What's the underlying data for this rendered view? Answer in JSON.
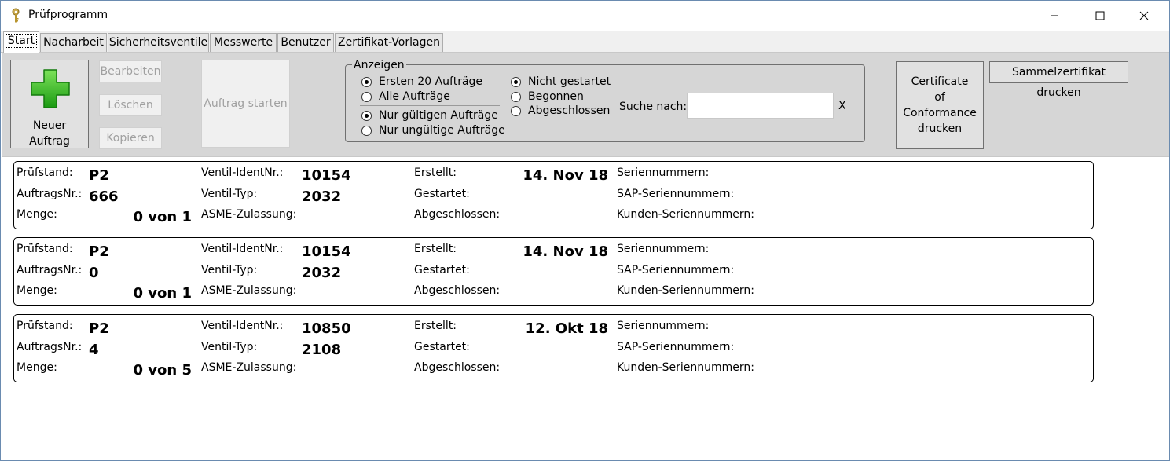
{
  "window": {
    "title": "Prüfprogramm",
    "minimize_glyph": "—",
    "maximize_glyph": "☐",
    "close_glyph": "✕"
  },
  "tabs": [
    "Start",
    "Nacharbeit",
    "Sicherheitsventile",
    "Messwerte",
    "Benutzer",
    "Zertifikat-Vorlagen"
  ],
  "toolbar": {
    "new_order_label_line1": "Neuer",
    "new_order_label_line2": "Auftrag",
    "edit_label": "Bearbeiten",
    "delete_label": "Löschen",
    "copy_label": "Kopieren",
    "start_order_label": "Auftrag starten",
    "coc_label": "Certificate\nof\nConformance\ndrucken",
    "collective_cert_label": "Sammelzertifikat drucken"
  },
  "filter": {
    "legend": "Anzeigen",
    "radios": {
      "first20": {
        "label": "Ersten 20 Aufträge",
        "checked": true
      },
      "all": {
        "label": "Alle Aufträge",
        "checked": false
      },
      "valid": {
        "label": "Nur gültigen Aufträge",
        "checked": true
      },
      "invalid": {
        "label": "Nur ungültige Aufträge",
        "checked": false
      },
      "not_started": {
        "label": "Nicht gestartet",
        "checked": true
      },
      "begun": {
        "label": "Begonnen",
        "checked": false
      },
      "finished": {
        "label": "Abgeschlossen",
        "checked": false
      }
    },
    "search_label": "Suche nach:",
    "search_value": "",
    "search_clear": "X"
  },
  "labels": {
    "pruefstand": "Prüfstand:",
    "auftragsnr": "AuftragsNr.:",
    "menge": "Menge:",
    "ventil_ident": "Ventil-IdentNr.:",
    "ventil_typ": "Ventil-Typ:",
    "asme": "ASME-Zulassung:",
    "erstellt": "Erstellt:",
    "gestartet": "Gestartet:",
    "abgeschlossen": "Abgeschlossen:",
    "seriennummern": "Seriennummern:",
    "sap_seriennummern": "SAP-Seriennummern:",
    "kunden_seriennummern": "Kunden-Seriennummern:"
  },
  "orders": [
    {
      "pruefstand": "P2",
      "auftragsnr": "666",
      "menge": "0 von 1",
      "ventil_ident": "10154",
      "ventil_typ": "2032",
      "erstellt": "14. Nov 18"
    },
    {
      "pruefstand": "P2",
      "auftragsnr": "0",
      "menge": "0 von 1",
      "ventil_ident": "10154",
      "ventil_typ": "2032",
      "erstellt": "14. Nov 18"
    },
    {
      "pruefstand": "P2",
      "auftragsnr": "4",
      "menge": "0 von 5",
      "ventil_ident": "10850",
      "ventil_typ": "2108",
      "erstellt": "12. Okt 18"
    }
  ]
}
